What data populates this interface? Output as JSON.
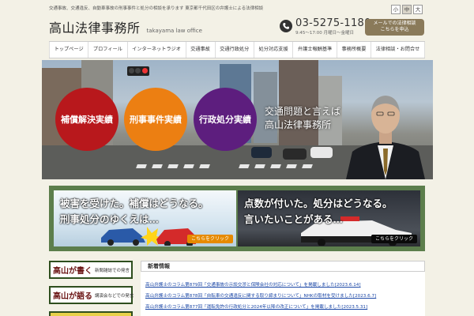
{
  "header": {
    "tagline": "交通事故、交通違反、自動車事故の刑事事件と処分の相談を承ります 東京都千代田区の弁護士による法律相談",
    "logo_main": "高山法律事務所",
    "logo_sub": "takayama law office",
    "phone_number": "03-5275-1180",
    "phone_hours": "9:45～17:00 月曜日～金曜日",
    "mail_line1": "メールでの法律相談",
    "mail_line2": "こちらを申込",
    "font_size_options": [
      "小",
      "中",
      "大"
    ],
    "font_size_selected": "中"
  },
  "nav": {
    "items": [
      "トップページ",
      "プロフィール",
      "インターネットラジオ",
      "交通事故",
      "交通行政処分",
      "処分対応支援",
      "弁護士報酬基準",
      "事務所概要",
      "法律相談・お問合せ"
    ]
  },
  "hero": {
    "circles": [
      "補償解決実績",
      "刑事事件実績",
      "行政処分実績"
    ],
    "line1": "交通問題と言えば",
    "line2": "高山法律事務所"
  },
  "banners": [
    {
      "line1": "被害を受けた。補償はどうなる。",
      "line2": "刑事処分のゆくえは…",
      "button": "こちらをクリック"
    },
    {
      "line1": "点数が付いた。処分はどうなる。",
      "line2": "言いたいことがある…",
      "button": "こちらをクリック"
    }
  ],
  "side_buttons": [
    {
      "big": "高山が書く",
      "small": "新聞雑誌での発言"
    },
    {
      "big": "高山が語る",
      "small": "講演会などでの発言"
    },
    {
      "big": "",
      "small": ""
    }
  ],
  "news": {
    "title": "新着情報",
    "items": [
      {
        "text": "高山弁護士のコラム第879回「交通事故の示談交渉と保険会社の対応について」を掲載しました",
        "date": "2023.6.14"
      },
      {
        "text": "高山弁護士のコラム第878回「自転車の交通違反に関する取り締まりについて」NHKの取材を受けました",
        "date": "2023.6.7"
      },
      {
        "text": "高山弁護士のコラム第877回「運転免許の行政処分と2024年以降の改正について」を掲載しました",
        "date": "2023.5.31"
      }
    ]
  },
  "colors": {
    "circle_red": "#b8181c",
    "circle_orange": "#ec7f12",
    "circle_purple": "#5d1e7e",
    "banner_frame": "#5c7e4c",
    "mail_button": "#8a7a5a",
    "link": "#1b47a6"
  }
}
